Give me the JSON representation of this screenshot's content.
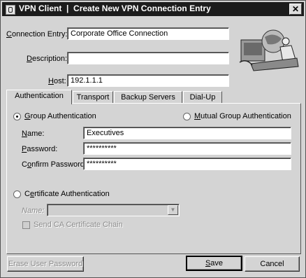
{
  "window": {
    "title": "VPN Client  |  Create New VPN Connection Entry",
    "close_glyph": "✕"
  },
  "form": {
    "connection_entry_label": "Connection Entry:",
    "connection_entry_value": "Corporate Office Connection",
    "description_label": "Description:",
    "description_value": "",
    "host_label": "Host:",
    "host_value": "192.1.1.1"
  },
  "tabs": [
    {
      "label": "Authentication",
      "active": true
    },
    {
      "label": "Transport",
      "active": false
    },
    {
      "label": "Backup Servers",
      "active": false
    },
    {
      "label": "Dial-Up",
      "active": false
    }
  ],
  "authentication": {
    "group_auth_label": "Group Authentication",
    "group_auth_selected": true,
    "mutual_group_auth_label": "Mutual Group Authentication",
    "mutual_group_auth_selected": false,
    "name_label": "Name:",
    "name_value": "Executives",
    "password_label": "Password:",
    "password_value": "**********",
    "confirm_password_label": "Confirm Password:",
    "confirm_password_value": "**********",
    "certificate_auth_label": "Certificate Authentication",
    "certificate_auth_selected": false,
    "cert_name_label": "Name:",
    "cert_name_value": "",
    "send_ca_chain_label": "Send CA Certificate Chain",
    "send_ca_chain_checked": false
  },
  "buttons": {
    "erase_user_password": "Erase User Password",
    "save": "Save",
    "cancel": "Cancel"
  },
  "colors": {
    "titlebar": "#1c1c1c",
    "dialog_bg": "#d4d4d4"
  }
}
